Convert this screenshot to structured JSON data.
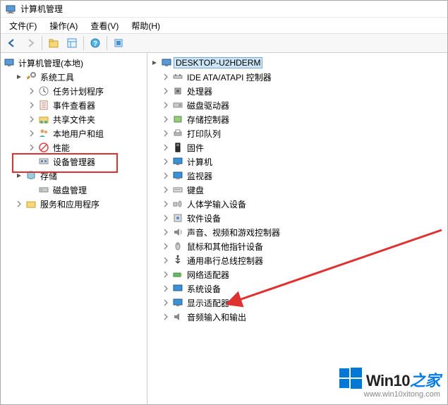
{
  "title": "计算机管理",
  "menu": {
    "file": "文件(F)",
    "action": "操作(A)",
    "view": "查看(V)",
    "help": "帮助(H)"
  },
  "left_tree": {
    "root": "计算机管理(本地)",
    "system_tools": "系统工具",
    "task_scheduler": "任务计划程序",
    "event_viewer": "事件查看器",
    "shared_folders": "共享文件夹",
    "local_users": "本地用户和组",
    "performance": "性能",
    "device_manager": "设备管理器",
    "storage": "存储",
    "disk_mgmt": "磁盘管理",
    "services_apps": "服务和应用程序"
  },
  "right_tree": {
    "root": "DESKTOP-U2HDERM",
    "ide": "IDE ATA/ATAPI 控制器",
    "cpu": "处理器",
    "disk_drives": "磁盘驱动器",
    "storage_ctrl": "存储控制器",
    "print_queue": "打印队列",
    "firmware": "固件",
    "computer": "计算机",
    "monitor": "监视器",
    "keyboard": "键盘",
    "hid": "人体学输入设备",
    "software_dev": "软件设备",
    "sound": "声音、视频和游戏控制器",
    "mouse": "鼠标和其他指针设备",
    "usb": "通用串行总线控制器",
    "network": "网络适配器",
    "sys_devices": "系统设备",
    "display": "显示适配器",
    "audio_io": "音频输入和输出"
  },
  "watermark": {
    "brand_a": "Win10",
    "brand_b": "之家",
    "url": "www.win10xitong.com"
  }
}
